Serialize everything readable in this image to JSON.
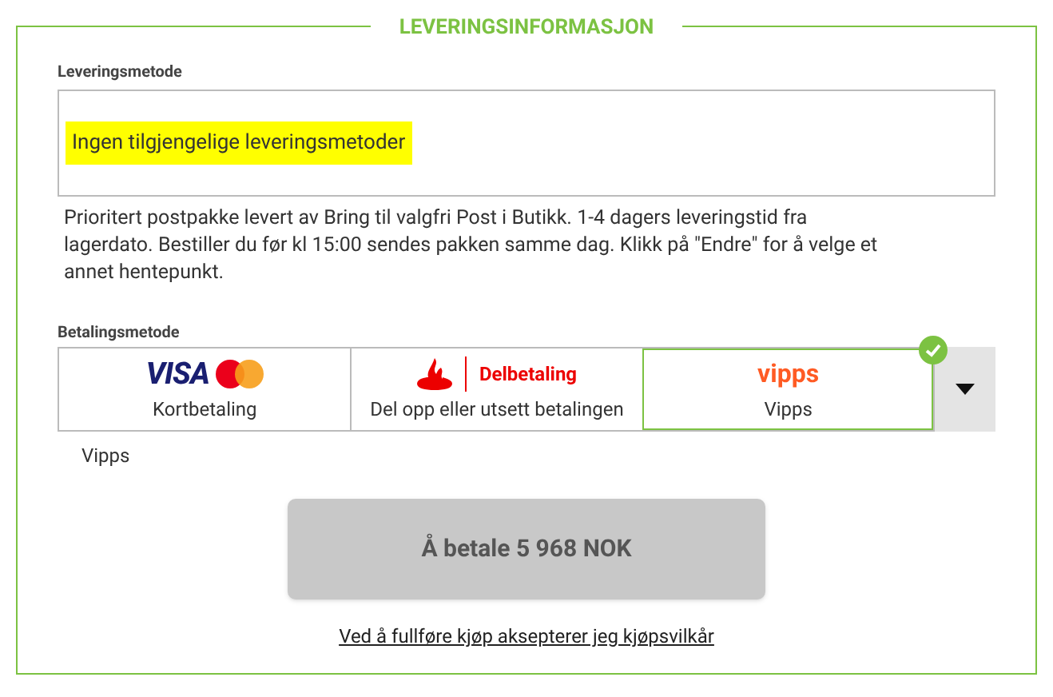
{
  "section": {
    "title": "LEVERINGSINFORMASJON"
  },
  "delivery": {
    "label": "Leveringsmetode",
    "value": "Ingen tilgjengelige leveringsmetoder",
    "highlighted": true,
    "description": "Prioritert postpakke levert av Bring til valgfri Post i Butikk. 1-4 dagers leveringstid fra lagerdato. Bestiller du før kl 15:00 sendes pakken samme dag. Klikk på \"Endre\" for å velge et annet hentepunkt."
  },
  "payment": {
    "label": "Betalingsmetode",
    "options": [
      {
        "kind": "card",
        "logo_text": "VISA",
        "caption": "Kortbetaling",
        "selected": false
      },
      {
        "kind": "santander",
        "logo_text": "Delbetaling",
        "caption": "Del opp eller utsett betalingen",
        "selected": false
      },
      {
        "kind": "vipps",
        "logo_text": "vipps",
        "caption": "Vipps",
        "selected": true
      }
    ],
    "chosen": "Vipps"
  },
  "pay_button": {
    "label": "Å betale 5 968 NOK",
    "disabled": true
  },
  "terms_link": "Ved å fullføre kjøp aksepterer jeg kjøpsvilkår"
}
